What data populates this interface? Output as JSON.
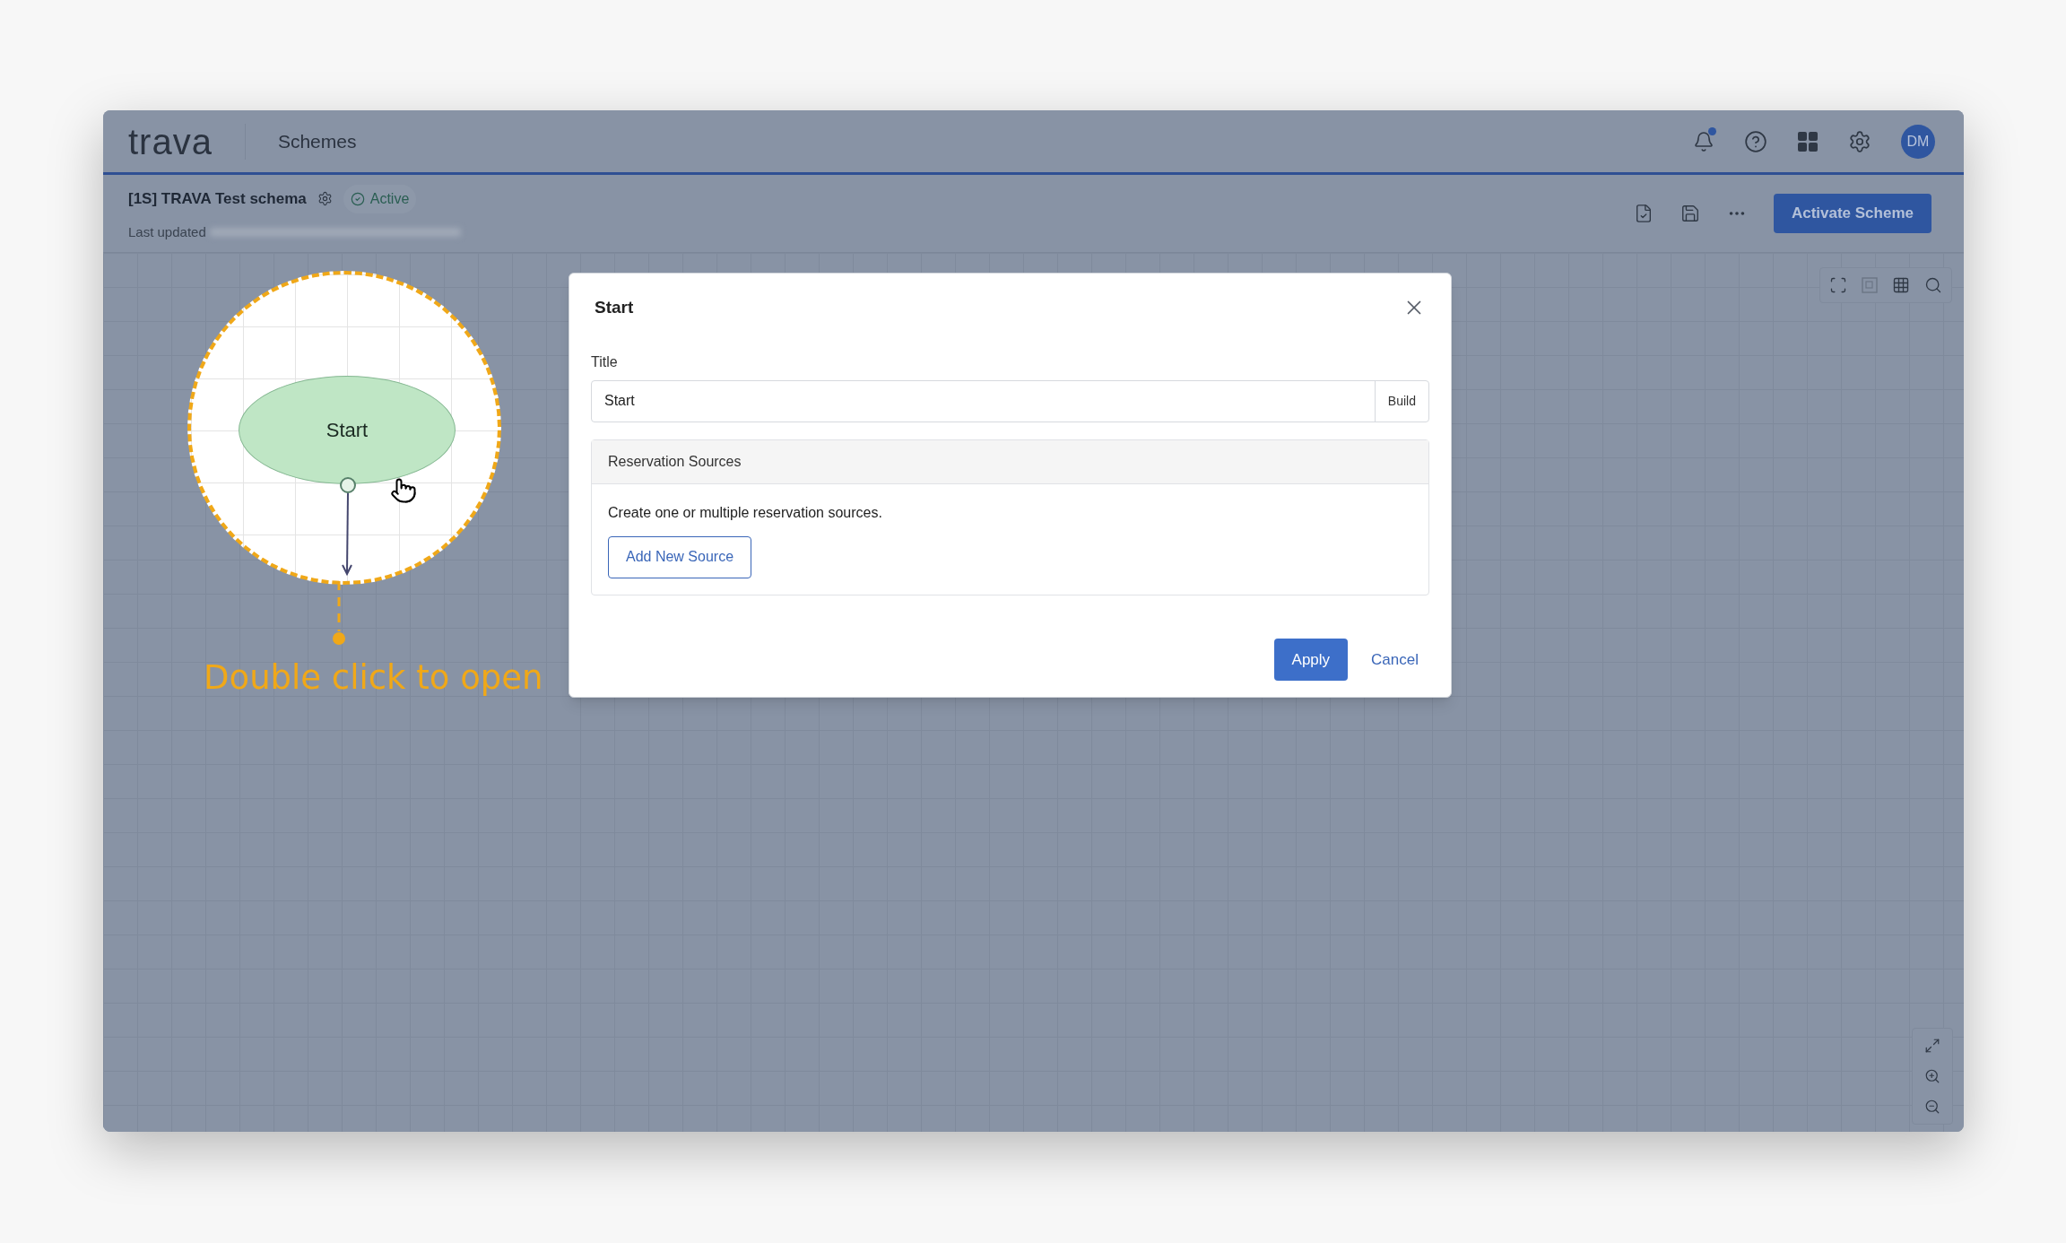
{
  "app": {
    "logo": "trava",
    "section": "Schemes",
    "avatar": "DM",
    "notifications_unread": true
  },
  "scheme": {
    "title": "[1S] TRAVA Test schema",
    "status": "Active",
    "last_updated_label": "Last updated",
    "action": "Activate Scheme"
  },
  "canvas": {
    "node": {
      "label": "Start"
    },
    "hint": "Double click to open"
  },
  "dialog": {
    "title": "Start",
    "field_label": "Title",
    "field_value": "Start",
    "field_button": "Build",
    "section_title": "Reservation Sources",
    "section_text": "Create one or multiple reservation sources.",
    "add_button": "Add New Source",
    "buttons": [
      {
        "label": "Apply",
        "kind": "primary"
      },
      {
        "label": "Cancel",
        "kind": "link"
      }
    ]
  }
}
